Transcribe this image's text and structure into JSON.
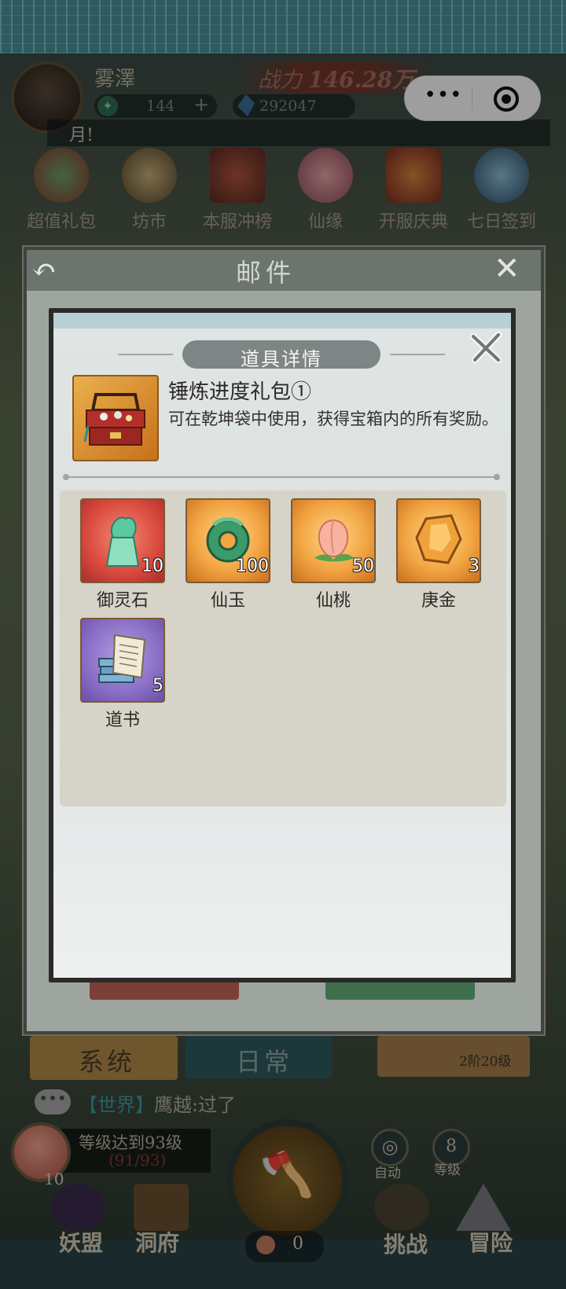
{
  "header": {
    "player_name": "雾澤",
    "power_label": "战力",
    "power_value": "146.28万",
    "currency_jade": "144",
    "currency_plus": "+",
    "currency_crystal": "292047",
    "chat_snippet": "月!"
  },
  "mini_program": {
    "more_glyph": "•••"
  },
  "activities": [
    {
      "label": "超值礼包",
      "icon": "gift-bag-icon"
    },
    {
      "label": "坊市",
      "icon": "coin-icon"
    },
    {
      "label": "本服冲榜",
      "icon": "ranking-gate-icon"
    },
    {
      "label": "仙缘",
      "icon": "lotus-icon"
    },
    {
      "label": "开服庆典",
      "icon": "gift-box-icon"
    },
    {
      "label": "七日签到",
      "icon": "moon-icon"
    }
  ],
  "mail": {
    "title": "邮件"
  },
  "detail": {
    "title": "道具详情",
    "item_name": "锤炼进度礼包①",
    "item_desc": "可在乾坤袋中使用，获得宝箱内的所有奖励。",
    "item_icon": "treasure-chest-icon"
  },
  "rewards": [
    {
      "name": "御灵石",
      "count": "10",
      "rarity": "red",
      "icon": "jade-seal-icon"
    },
    {
      "name": "仙玉",
      "count": "100",
      "rarity": "orange",
      "icon": "jade-dragon-icon"
    },
    {
      "name": "仙桃",
      "count": "50",
      "rarity": "orange",
      "icon": "peach-icon"
    },
    {
      "name": "庚金",
      "count": "3",
      "rarity": "orange",
      "icon": "gold-ore-icon"
    },
    {
      "name": "道书",
      "count": "5",
      "rarity": "purple",
      "icon": "book-icon"
    }
  ],
  "bottom": {
    "tab_system": "系统",
    "tab_daily": "日常",
    "stage": "2阶20级",
    "world_tag": "【世界】",
    "world_msg": "鹰越:过了",
    "chat_icon_glyph": "•••",
    "peach_count": "10",
    "quest_line1": "等级达到93级",
    "quest_line2": "(91/93)",
    "auto_label": "自动",
    "speed_value": "8",
    "speed_label": "等级",
    "cost_value": "0",
    "nav": [
      "妖盟",
      "洞府",
      "挑战",
      "冒险"
    ]
  },
  "colors": {
    "orange_rarity": "#f2a542",
    "red_rarity": "#d9493e",
    "purple_rarity": "#8a6fc6",
    "title_pill": "#7d8585"
  }
}
